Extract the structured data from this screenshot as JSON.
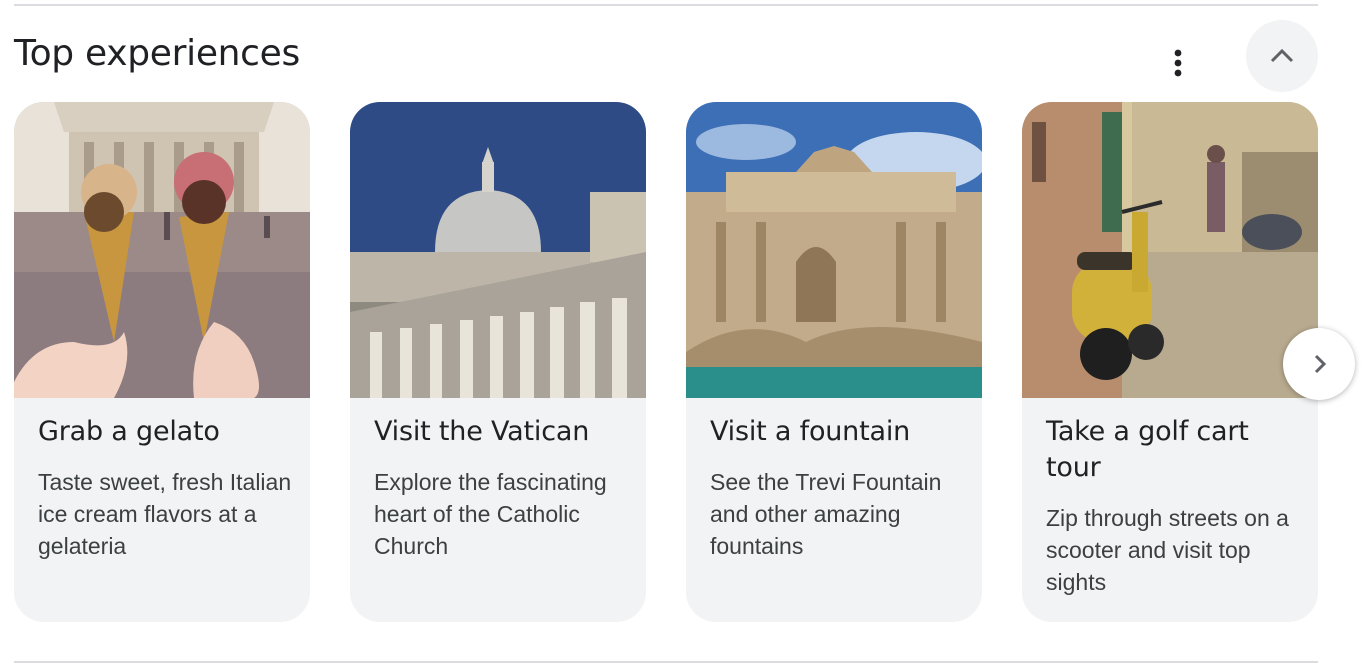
{
  "section": {
    "title": "Top experiences",
    "more_icon": "more-vert-icon",
    "collapse_icon": "chevron-up-icon",
    "next_icon": "chevron-right-icon"
  },
  "cards": [
    {
      "title": "Grab a gelato",
      "description": "Taste sweet, fresh Italian ice cream flavors at a gelateria",
      "image": "gelato-photo"
    },
    {
      "title": "Visit the Vatican",
      "description": "Explore the fascinating heart of the Catholic Church",
      "image": "vatican-photo"
    },
    {
      "title": "Visit a fountain",
      "description": "See the Trevi Fountain and other amazing fountains",
      "image": "trevi-fountain-photo"
    },
    {
      "title": "Take a golf cart tour",
      "description": "Zip through streets on a scooter and visit top sights",
      "image": "scooter-street-photo"
    }
  ],
  "colors": {
    "card_bg": "#f1f3f4",
    "text": "#202124",
    "secondary_text": "#3c4043",
    "divider": "#dadce0"
  }
}
